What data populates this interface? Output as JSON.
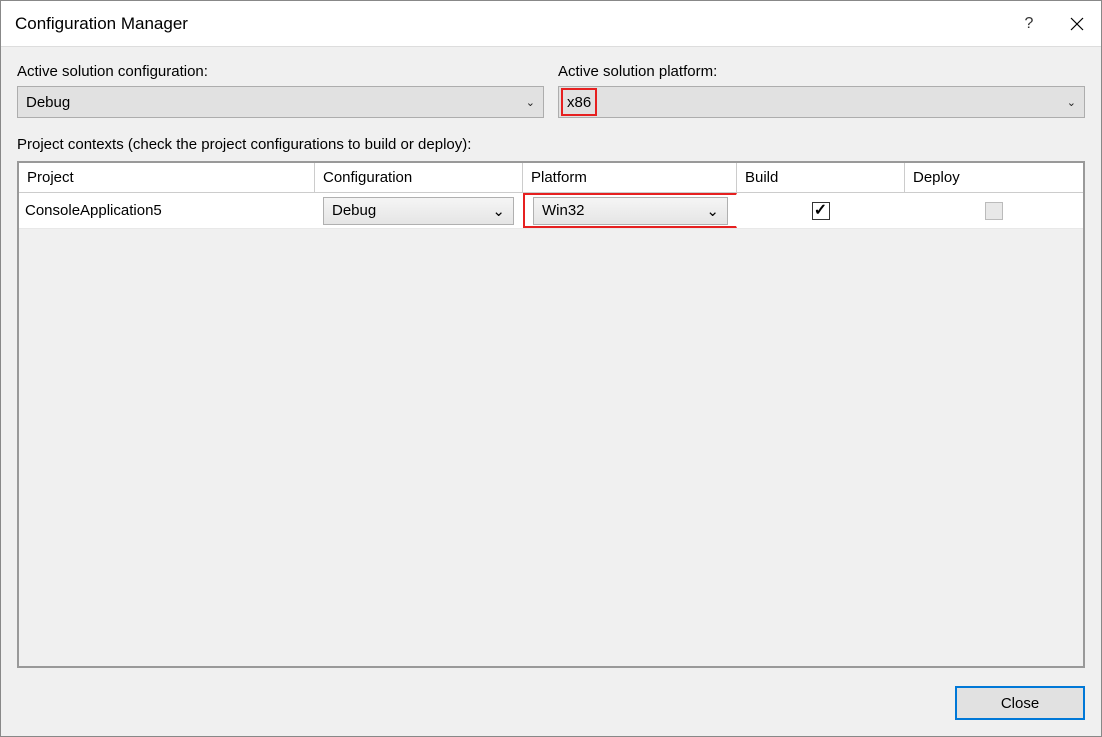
{
  "window": {
    "title": "Configuration Manager",
    "help_symbol": "?",
    "close_label": "Close"
  },
  "fields": {
    "config_label": "Active solution configuration:",
    "config_value": "Debug",
    "platform_label": "Active solution platform:",
    "platform_value": "x86"
  },
  "contexts_label": "Project contexts (check the project configurations to build or deploy):",
  "columns": {
    "project": "Project",
    "configuration": "Configuration",
    "platform": "Platform",
    "build": "Build",
    "deploy": "Deploy"
  },
  "rows": [
    {
      "project": "ConsoleApplication5",
      "configuration": "Debug",
      "platform": "Win32",
      "build": true,
      "deploy_disabled": true
    }
  ]
}
